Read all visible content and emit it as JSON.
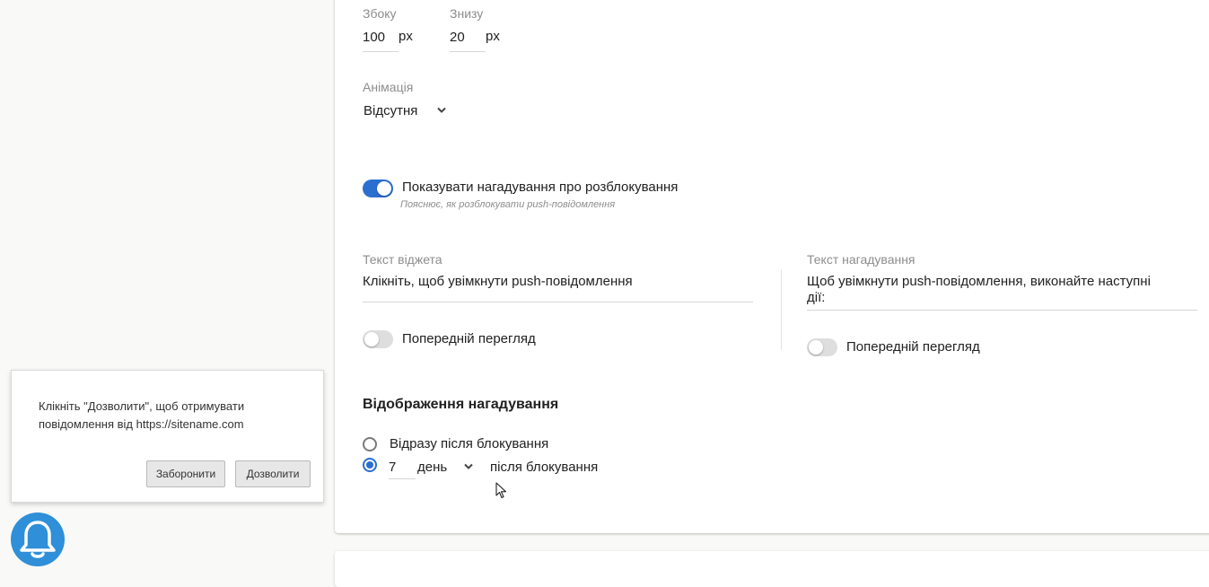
{
  "position": {
    "side_label": "Збоку",
    "side_value": "100",
    "bottom_label": "Знизу",
    "bottom_value": "20",
    "unit": "px"
  },
  "animation": {
    "label": "Анімація",
    "value": "Відсутня"
  },
  "reminder_toggle": {
    "label": "Показувати нагадування про розблокування",
    "hint": "Пояснює, як розблокувати push-повідомлення",
    "enabled": true
  },
  "widget_text": {
    "label": "Текст віджета",
    "value": "Клікніть, щоб увімкнути push-повідомлення",
    "preview_label": "Попередній перегляд"
  },
  "reminder_text": {
    "label": "Текст нагадування",
    "value_line1": "Щоб увімкнути push-повідомлення, виконайте наступні",
    "value_line2": "дії:",
    "preview_label": "Попередній перегляд"
  },
  "display": {
    "heading": "Відображення нагадування",
    "option_immediately": "Відразу після блокування",
    "delay_value": "7",
    "delay_unit": "день",
    "after_blocking": "після блокування"
  },
  "popup": {
    "message": "Клікніть \"Дозволити\", щоб отримувати повідомлення від https://sitename.com",
    "deny_label": "Заборонити",
    "allow_label": "Дозволити"
  },
  "colors": {
    "accent": "#2a6fd0",
    "bell": "#2f8fd8"
  },
  "icons": [
    "chevron-down-icon",
    "bell-icon",
    "cursor-icon"
  ]
}
